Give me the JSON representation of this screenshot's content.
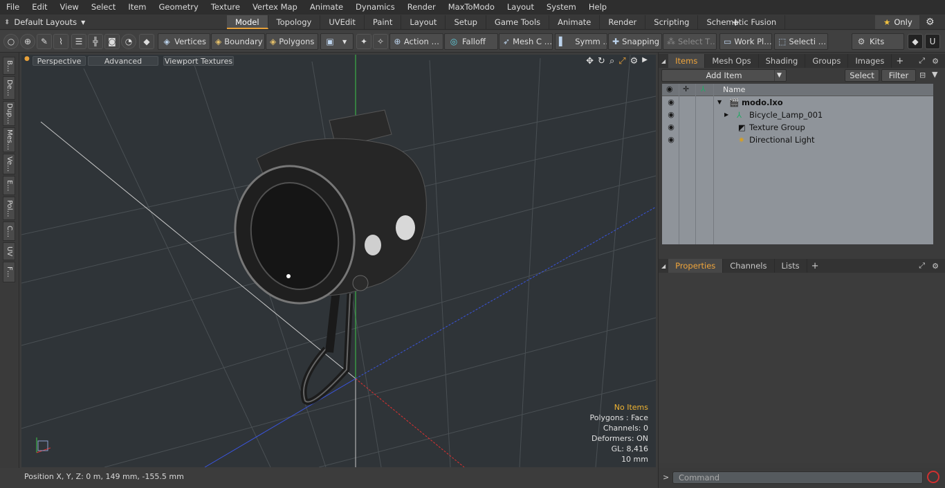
{
  "menu": [
    "File",
    "Edit",
    "View",
    "Select",
    "Item",
    "Geometry",
    "Texture",
    "Vertex Map",
    "Animate",
    "Dynamics",
    "Render",
    "MaxToModo",
    "Layout",
    "System",
    "Help"
  ],
  "layouts": {
    "label": "Default Layouts"
  },
  "mode_tabs": [
    "Model",
    "Topology",
    "UVEdit",
    "Paint",
    "Layout",
    "Setup",
    "Game Tools",
    "Animate",
    "Render",
    "Scripting",
    "Schematic Fusion"
  ],
  "active_mode_tab": "Model",
  "only_label": "Only",
  "toolbar": {
    "vertices": "Vertices",
    "boundary": "Boundary",
    "polygons": "Polygons",
    "action": "Action …",
    "falloff": "Falloff",
    "mesh": "Mesh C …",
    "symm": "Symm …",
    "snapping": "Snapping",
    "select_t": "Select T…",
    "work_pl": "Work Pl…",
    "selecti": "Selecti …",
    "kits": "Kits"
  },
  "left_tabs": [
    "B…",
    "De…",
    "Dup…",
    "Mes…",
    "Ve…",
    "E…",
    "Pol…",
    "C…",
    "UV",
    "F…"
  ],
  "viewport": {
    "perspective": "Perspective",
    "advanced": "Advanced",
    "viewport_textures": "Viewport Textures",
    "info": {
      "no_items": "No Items",
      "polygons": "Polygons : Face",
      "channels": "Channels: 0",
      "deformers": "Deformers: ON",
      "gl": "GL: 8,416",
      "scale": "10 mm"
    }
  },
  "status": {
    "position": "Position X, Y, Z:   0 m, 149 mm, -155.5 mm"
  },
  "items_panel": {
    "tabs": [
      "Items",
      "Mesh Ops",
      "Shading",
      "Groups",
      "Images"
    ],
    "active_tab": "Items",
    "add_item": "Add Item",
    "select": "Select",
    "filter": "Filter",
    "name_header": "Name",
    "tree": [
      {
        "label": "modo.lxo",
        "icon": "scene-icon"
      },
      {
        "label": "Bicycle_Lamp_001",
        "icon": "mesh-icon"
      },
      {
        "label": "Texture Group",
        "icon": "texture-group-icon"
      },
      {
        "label": "Directional Light",
        "icon": "light-icon"
      }
    ]
  },
  "properties_panel": {
    "tabs": [
      "Properties",
      "Channels",
      "Lists"
    ],
    "active_tab": "Properties"
  },
  "command": {
    "placeholder": "Command"
  },
  "colors": {
    "accent": "#f0a53b",
    "viewport_bg": "#2f3438",
    "x_axis": "#e03030",
    "y_axis": "#3fc94a",
    "z_axis": "#3a55e0"
  }
}
